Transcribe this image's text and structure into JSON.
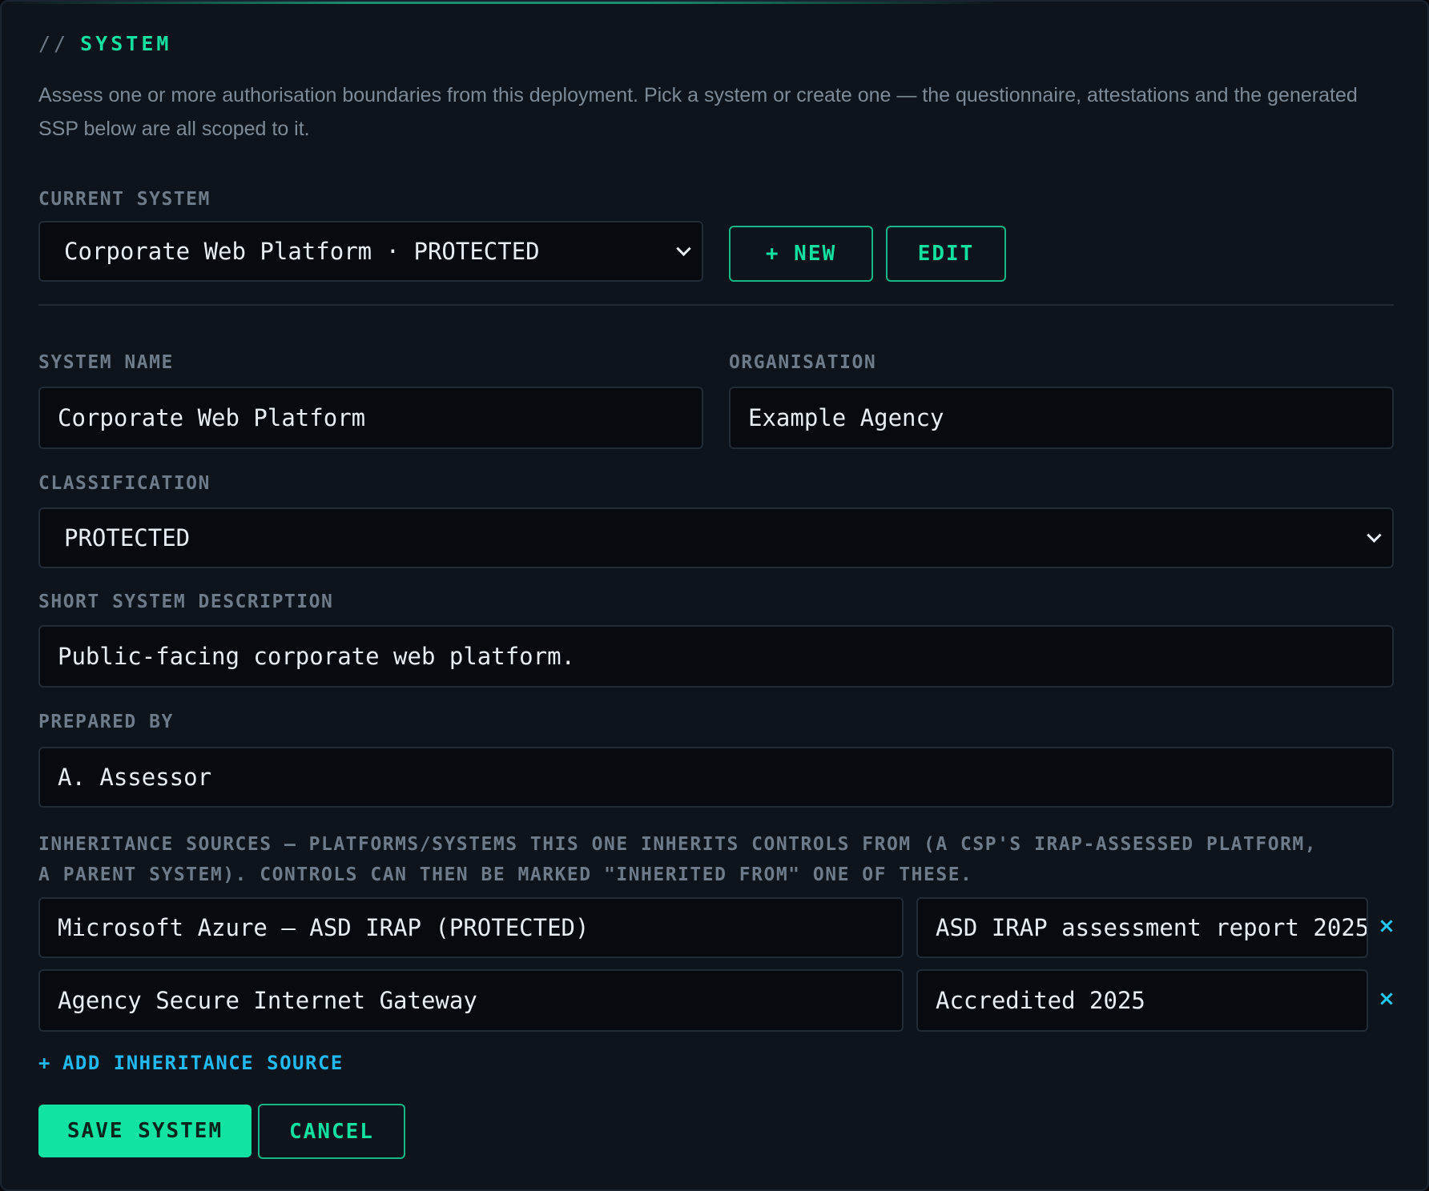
{
  "section": {
    "prefix": "//",
    "title": "SYSTEM",
    "description": "Assess one or more authorisation boundaries from this deployment. Pick a system or create one — the questionnaire, attestations and the generated SSP below are all scoped to it."
  },
  "current_system": {
    "label": "CURRENT SYSTEM",
    "selected": "Corporate Web Platform · PROTECTED",
    "new_button": "+ NEW",
    "edit_button": "EDIT"
  },
  "form": {
    "system_name": {
      "label": "SYSTEM NAME",
      "value": "Corporate Web Platform"
    },
    "organisation": {
      "label": "ORGANISATION",
      "value": "Example Agency"
    },
    "classification": {
      "label": "CLASSIFICATION",
      "value": "PROTECTED"
    },
    "description": {
      "label": "SHORT SYSTEM DESCRIPTION",
      "value": "Public-facing corporate web platform."
    },
    "prepared_by": {
      "label": "PREPARED BY",
      "value": "A. Assessor"
    }
  },
  "inheritance": {
    "label_line1": "INHERITANCE SOURCES — PLATFORMS/SYSTEMS THIS ONE INHERITS CONTROLS FROM (A CSP'S IRAP-ASSESSED PLATFORM,",
    "label_line2": "A PARENT SYSTEM). CONTROLS CAN THEN BE MARKED \"INHERITED FROM\" ONE OF THESE.",
    "sources": [
      {
        "name": "Microsoft Azure — ASD IRAP (PROTECTED)",
        "reference": "ASD IRAP assessment report 2025"
      },
      {
        "name": "Agency Secure Internet Gateway",
        "reference": "Accredited 2025"
      }
    ],
    "remove_symbol": "×",
    "add_label": "ADD INHERITANCE SOURCE",
    "add_symbol": "+"
  },
  "actions": {
    "save": "SAVE SYSTEM",
    "cancel": "CANCEL"
  },
  "colors": {
    "accent": "#12e0a0",
    "link": "#22b8f0",
    "background": "#0e141b",
    "field_background": "#070b10"
  }
}
